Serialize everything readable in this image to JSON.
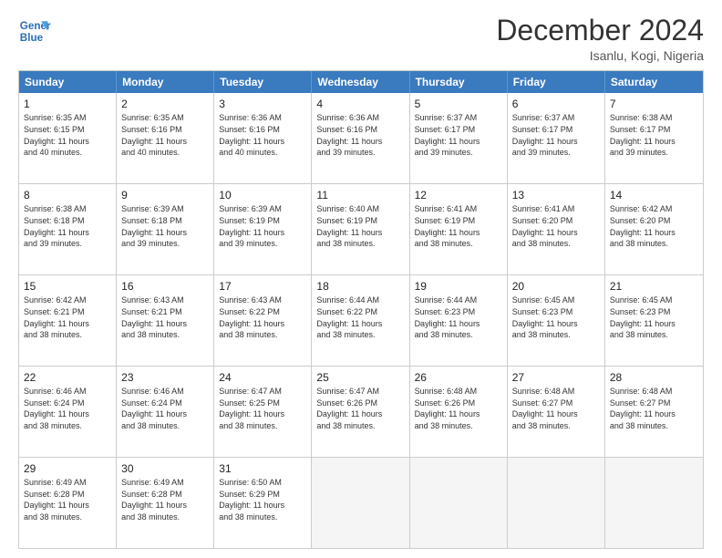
{
  "header": {
    "logo_line1": "General",
    "logo_line2": "Blue",
    "title": "December 2024",
    "location": "Isanlu, Kogi, Nigeria"
  },
  "days_of_week": [
    "Sunday",
    "Monday",
    "Tuesday",
    "Wednesday",
    "Thursday",
    "Friday",
    "Saturday"
  ],
  "rows": [
    [
      {
        "day": "1",
        "info": "Sunrise: 6:35 AM\nSunset: 6:15 PM\nDaylight: 11 hours\nand 40 minutes."
      },
      {
        "day": "2",
        "info": "Sunrise: 6:35 AM\nSunset: 6:16 PM\nDaylight: 11 hours\nand 40 minutes."
      },
      {
        "day": "3",
        "info": "Sunrise: 6:36 AM\nSunset: 6:16 PM\nDaylight: 11 hours\nand 40 minutes."
      },
      {
        "day": "4",
        "info": "Sunrise: 6:36 AM\nSunset: 6:16 PM\nDaylight: 11 hours\nand 39 minutes."
      },
      {
        "day": "5",
        "info": "Sunrise: 6:37 AM\nSunset: 6:17 PM\nDaylight: 11 hours\nand 39 minutes."
      },
      {
        "day": "6",
        "info": "Sunrise: 6:37 AM\nSunset: 6:17 PM\nDaylight: 11 hours\nand 39 minutes."
      },
      {
        "day": "7",
        "info": "Sunrise: 6:38 AM\nSunset: 6:17 PM\nDaylight: 11 hours\nand 39 minutes."
      }
    ],
    [
      {
        "day": "8",
        "info": "Sunrise: 6:38 AM\nSunset: 6:18 PM\nDaylight: 11 hours\nand 39 minutes."
      },
      {
        "day": "9",
        "info": "Sunrise: 6:39 AM\nSunset: 6:18 PM\nDaylight: 11 hours\nand 39 minutes."
      },
      {
        "day": "10",
        "info": "Sunrise: 6:39 AM\nSunset: 6:19 PM\nDaylight: 11 hours\nand 39 minutes."
      },
      {
        "day": "11",
        "info": "Sunrise: 6:40 AM\nSunset: 6:19 PM\nDaylight: 11 hours\nand 38 minutes."
      },
      {
        "day": "12",
        "info": "Sunrise: 6:41 AM\nSunset: 6:19 PM\nDaylight: 11 hours\nand 38 minutes."
      },
      {
        "day": "13",
        "info": "Sunrise: 6:41 AM\nSunset: 6:20 PM\nDaylight: 11 hours\nand 38 minutes."
      },
      {
        "day": "14",
        "info": "Sunrise: 6:42 AM\nSunset: 6:20 PM\nDaylight: 11 hours\nand 38 minutes."
      }
    ],
    [
      {
        "day": "15",
        "info": "Sunrise: 6:42 AM\nSunset: 6:21 PM\nDaylight: 11 hours\nand 38 minutes."
      },
      {
        "day": "16",
        "info": "Sunrise: 6:43 AM\nSunset: 6:21 PM\nDaylight: 11 hours\nand 38 minutes."
      },
      {
        "day": "17",
        "info": "Sunrise: 6:43 AM\nSunset: 6:22 PM\nDaylight: 11 hours\nand 38 minutes."
      },
      {
        "day": "18",
        "info": "Sunrise: 6:44 AM\nSunset: 6:22 PM\nDaylight: 11 hours\nand 38 minutes."
      },
      {
        "day": "19",
        "info": "Sunrise: 6:44 AM\nSunset: 6:23 PM\nDaylight: 11 hours\nand 38 minutes."
      },
      {
        "day": "20",
        "info": "Sunrise: 6:45 AM\nSunset: 6:23 PM\nDaylight: 11 hours\nand 38 minutes."
      },
      {
        "day": "21",
        "info": "Sunrise: 6:45 AM\nSunset: 6:23 PM\nDaylight: 11 hours\nand 38 minutes."
      }
    ],
    [
      {
        "day": "22",
        "info": "Sunrise: 6:46 AM\nSunset: 6:24 PM\nDaylight: 11 hours\nand 38 minutes."
      },
      {
        "day": "23",
        "info": "Sunrise: 6:46 AM\nSunset: 6:24 PM\nDaylight: 11 hours\nand 38 minutes."
      },
      {
        "day": "24",
        "info": "Sunrise: 6:47 AM\nSunset: 6:25 PM\nDaylight: 11 hours\nand 38 minutes."
      },
      {
        "day": "25",
        "info": "Sunrise: 6:47 AM\nSunset: 6:26 PM\nDaylight: 11 hours\nand 38 minutes."
      },
      {
        "day": "26",
        "info": "Sunrise: 6:48 AM\nSunset: 6:26 PM\nDaylight: 11 hours\nand 38 minutes."
      },
      {
        "day": "27",
        "info": "Sunrise: 6:48 AM\nSunset: 6:27 PM\nDaylight: 11 hours\nand 38 minutes."
      },
      {
        "day": "28",
        "info": "Sunrise: 6:48 AM\nSunset: 6:27 PM\nDaylight: 11 hours\nand 38 minutes."
      }
    ],
    [
      {
        "day": "29",
        "info": "Sunrise: 6:49 AM\nSunset: 6:28 PM\nDaylight: 11 hours\nand 38 minutes."
      },
      {
        "day": "30",
        "info": "Sunrise: 6:49 AM\nSunset: 6:28 PM\nDaylight: 11 hours\nand 38 minutes."
      },
      {
        "day": "31",
        "info": "Sunrise: 6:50 AM\nSunset: 6:29 PM\nDaylight: 11 hours\nand 38 minutes."
      },
      {
        "day": "",
        "info": ""
      },
      {
        "day": "",
        "info": ""
      },
      {
        "day": "",
        "info": ""
      },
      {
        "day": "",
        "info": ""
      }
    ]
  ]
}
